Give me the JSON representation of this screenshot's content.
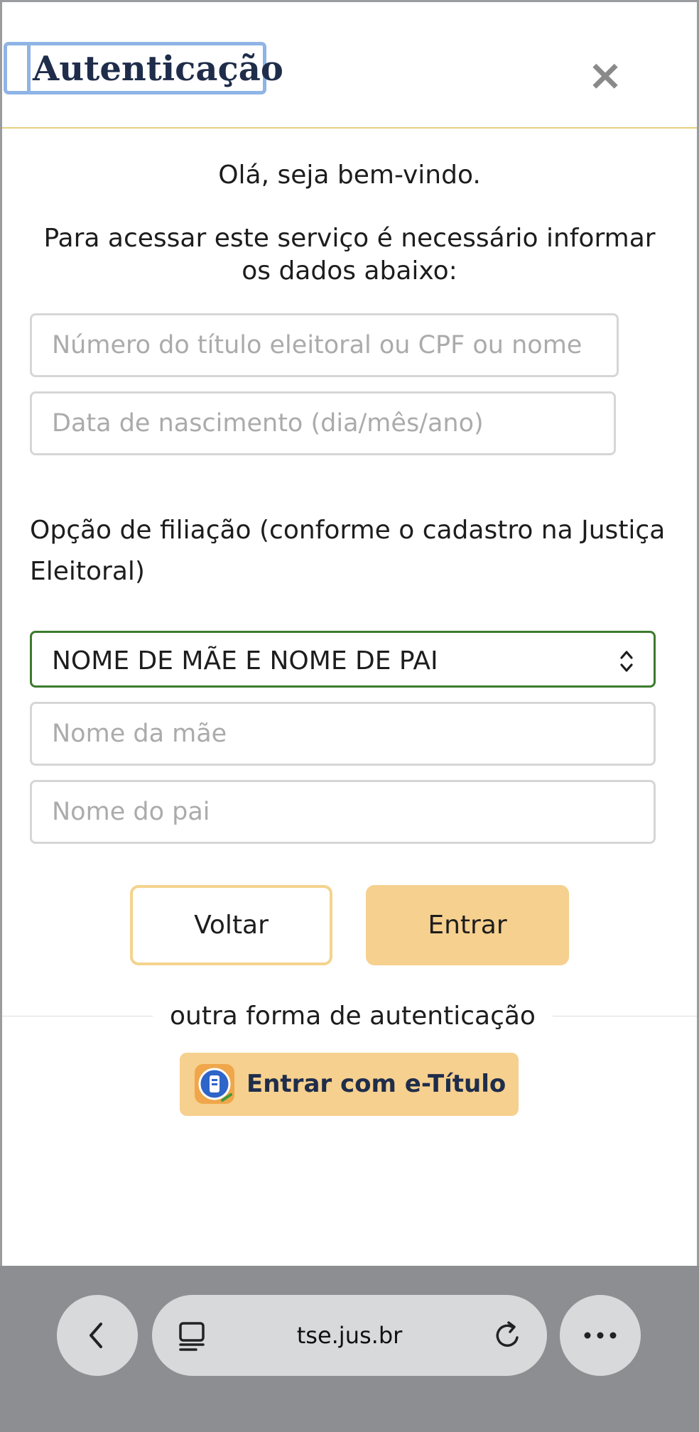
{
  "modal": {
    "title": "Autenticação",
    "close_symbol": "×",
    "welcome": "Olá, seja bem-vindo.",
    "instructions": "Para acessar este serviço é necessário informar os dados abaixo:"
  },
  "form": {
    "id_placeholder": "Número do título eleitoral ou CPF ou nome",
    "birth_placeholder": "Data de nascimento (dia/mês/ano)",
    "filiation_label": "Opção de filiação (conforme o cadastro na Justiça Eleitoral)",
    "filiation_selected": "NOME DE MÃE E NOME DE PAI",
    "mother_placeholder": "Nome da mãe",
    "father_placeholder": "Nome do pai"
  },
  "actions": {
    "back_label": "Voltar",
    "enter_label": "Entrar",
    "alt_divider_label": "outra forma de autenticação",
    "etitulo_label": "Entrar com e-Título"
  },
  "browser": {
    "url": "tse.jus.br",
    "icons": {
      "back": "chevron-left-icon",
      "tabs": "tabs-icon",
      "reload": "reload-icon",
      "more": "more-icon"
    }
  },
  "colors": {
    "title": "#1f2d4b",
    "accent_yellow": "#f6d08e",
    "select_border": "#3c7a2d",
    "focus_ring": "#8fb4e6",
    "browser_bar": "#8c8e92"
  }
}
